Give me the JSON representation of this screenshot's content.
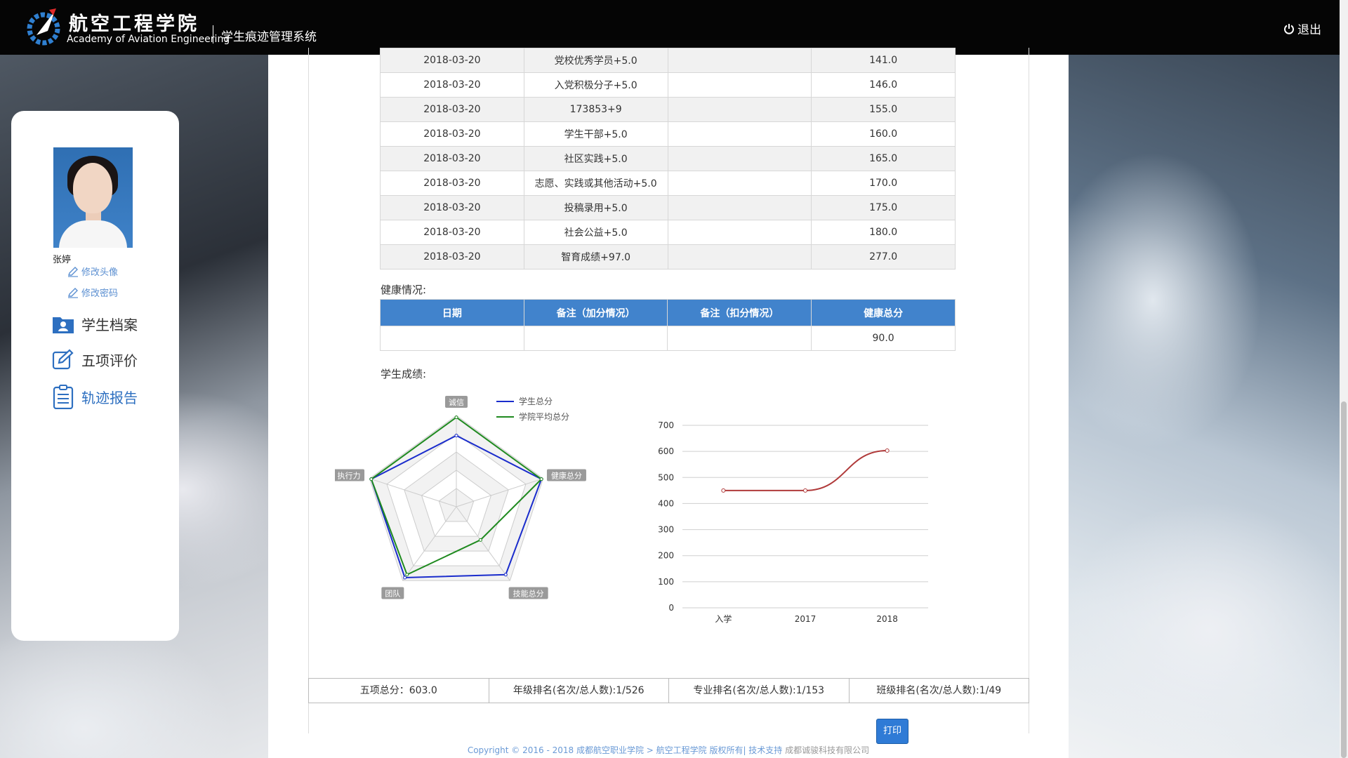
{
  "header": {
    "school_cn": "航空工程学院",
    "school_en": "Academy of Aviation Engineering",
    "system_name": "学生痕迹管理系统",
    "logout_label": "退出"
  },
  "sidebar": {
    "user_name": "张婷",
    "change_avatar": "修改头像",
    "change_password": "修改密码",
    "nav": [
      {
        "label": "学生档案",
        "icon": "student-file-icon"
      },
      {
        "label": "五项评价",
        "icon": "edit-icon"
      },
      {
        "label": "轨迹报告",
        "icon": "report-icon",
        "active": true
      }
    ]
  },
  "score_rows": [
    {
      "date": "2018-03-20",
      "note": "党校优秀学员+5.0",
      "deduct": "",
      "total": "141.0"
    },
    {
      "date": "2018-03-20",
      "note": "入党积极分子+5.0",
      "deduct": "",
      "total": "146.0"
    },
    {
      "date": "2018-03-20",
      "note": "173853+9",
      "deduct": "",
      "total": "155.0"
    },
    {
      "date": "2018-03-20",
      "note": "学生干部+5.0",
      "deduct": "",
      "total": "160.0"
    },
    {
      "date": "2018-03-20",
      "note": "社区实践+5.0",
      "deduct": "",
      "total": "165.0"
    },
    {
      "date": "2018-03-20",
      "note": "志愿、实践或其他活动+5.0",
      "deduct": "",
      "total": "170.0"
    },
    {
      "date": "2018-03-20",
      "note": "投稿录用+5.0",
      "deduct": "",
      "total": "175.0"
    },
    {
      "date": "2018-03-20",
      "note": "社会公益+5.0",
      "deduct": "",
      "total": "180.0"
    },
    {
      "date": "2018-03-20",
      "note": "智育成绩+97.0",
      "deduct": "",
      "total": "277.0"
    }
  ],
  "health": {
    "label": "健康情况:",
    "headers": [
      "日期",
      "备注（加分情况）",
      "备注（扣分情况）",
      "健康总分"
    ],
    "row": [
      "",
      "",
      "",
      "90.0"
    ]
  },
  "scores_label": "学生成绩:",
  "chart_data": [
    {
      "type": "radar",
      "indicators": [
        "诚信",
        "健康总分",
        "技能总分",
        "团队",
        "执行力"
      ],
      "series": [
        {
          "name": "学生总分",
          "color": "#1a2ccc",
          "values": [
            0.78,
            0.98,
            0.92,
            0.96,
            0.98
          ]
        },
        {
          "name": "学院平均总分",
          "color": "#1f8a1f",
          "values": [
            0.98,
            0.98,
            0.45,
            0.92,
            0.98
          ]
        }
      ],
      "legend": "top"
    },
    {
      "type": "line",
      "categories": [
        "入学",
        "2017",
        "2018"
      ],
      "series": [
        {
          "color": "#b03a3a",
          "values": [
            450,
            450,
            603
          ]
        }
      ],
      "ylim": [
        0,
        700
      ],
      "yticks": [
        0,
        100,
        200,
        300,
        400,
        500,
        600,
        700
      ],
      "grid": true
    }
  ],
  "summary": {
    "total": "五项总分：603.0",
    "grade_rank": "年级排名(名次/总人数):1/526",
    "major_rank": "专业排名(名次/总人数):1/153",
    "class_rank": "班级排名(名次/总人数):1/49"
  },
  "print_label": "打印",
  "footer": {
    "copyright": "Copyright © 2016 - 2018 成都航空职业学院 > 航空工程学院 版权所有| 技术支持",
    "company": "成都诚骏科技有限公司"
  }
}
